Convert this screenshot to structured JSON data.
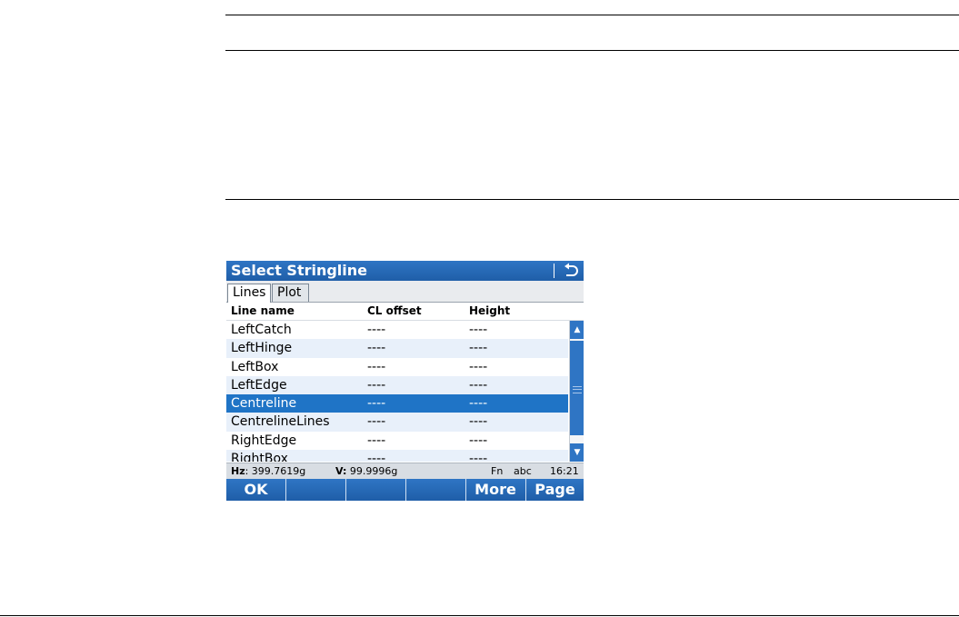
{
  "title": "Select Stringline",
  "tabs": [
    "Lines",
    "Plot"
  ],
  "columns": {
    "name": "Line name",
    "offset": "CL offset",
    "height": "Height"
  },
  "rows": [
    {
      "name": "LeftCatch",
      "offset": "----",
      "height": "----"
    },
    {
      "name": "LeftHinge",
      "offset": "----",
      "height": "----"
    },
    {
      "name": "LeftBox",
      "offset": "----",
      "height": "----"
    },
    {
      "name": "LeftEdge",
      "offset": "----",
      "height": "----"
    },
    {
      "name": "Centreline",
      "offset": "----",
      "height": "----"
    },
    {
      "name": "CentrelineLines",
      "offset": "----",
      "height": "----"
    },
    {
      "name": "RightEdge",
      "offset": "----",
      "height": "----"
    },
    {
      "name": "RightBox",
      "offset": "----",
      "height": "----"
    }
  ],
  "selected_row": 4,
  "status": {
    "hz_label": "Hz",
    "hz_value": ": 399.7619g",
    "v_label": "V:",
    "v_value": " 99.9996g",
    "fn": "Fn",
    "input_mode": "abc",
    "time": "16:21"
  },
  "softkeys": [
    "OK",
    "",
    "",
    "",
    "More",
    "Page"
  ],
  "colors": {
    "accent": "#1f74c6",
    "status_bg": "#d8dde3"
  }
}
